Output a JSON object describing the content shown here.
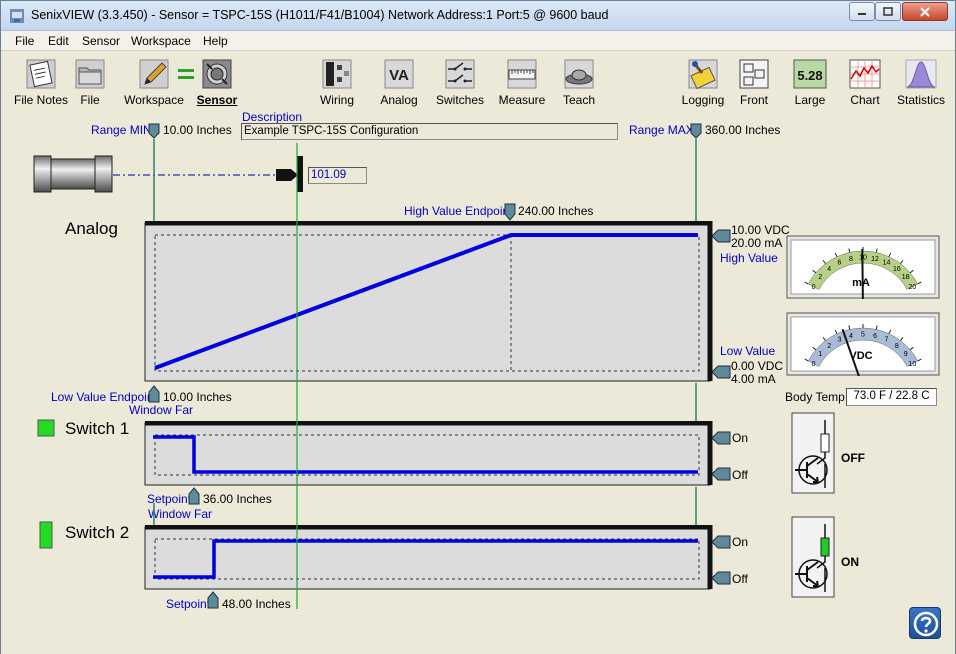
{
  "window": {
    "title": "SenixVIEW (3.3.450) - Sensor = TSPC-15S (H1011/F41/B1004)  Network Address:1  Port:5 @ 9600 baud"
  },
  "menu": [
    "File",
    "Edit",
    "Sensor",
    "Workspace",
    "Help"
  ],
  "toolbar": {
    "file_notes": "File Notes",
    "file": "File",
    "workspace": "Workspace",
    "sensor": "Sensor",
    "wiring": "Wiring",
    "analog": "Analog",
    "switches": "Switches",
    "measure": "Measure",
    "teach": "Teach",
    "logging": "Logging",
    "front": "Front",
    "large": "Large",
    "large_value": "5.28",
    "chart": "Chart",
    "statistics": "Statistics",
    "analog_icon_text": "VA"
  },
  "range": {
    "min_label": "Range MIN",
    "min_value": "10.00 Inches",
    "max_label": "Range MAX",
    "max_value": "360.00 Inches",
    "description_label": "Description",
    "description_value": "Example TSPC-15S Configuration",
    "target_reading": "101.09"
  },
  "analog": {
    "title": "Analog",
    "high_endpoint_label": "High Value Endpoint",
    "high_endpoint_value": "240.00 Inches",
    "low_endpoint_label": "Low Value Endpoint",
    "low_endpoint_value": "10.00 Inches",
    "window_far": "Window Far",
    "high_vdc": "10.00 VDC",
    "high_ma": "20.00 mA",
    "high_value_label": "High Value",
    "low_value_label": "Low Value",
    "low_vdc": "0.00 VDC",
    "low_ma": "4.00 mA"
  },
  "meters": {
    "ma_label": "mA",
    "ma_ticks": [
      "0",
      "2",
      "4",
      "6",
      "8",
      "10",
      "12",
      "14",
      "16",
      "18",
      "20"
    ],
    "ma_reading": 9.9,
    "vdc_label": "VDC",
    "vdc_ticks": [
      "0",
      "1",
      "2",
      "3",
      "4",
      "5",
      "6",
      "7",
      "8",
      "9",
      "10"
    ],
    "vdc_reading": 3.5,
    "body_temp_label": "Body Temp:",
    "body_temp_value": "73.0 F / 22.8 C"
  },
  "switch1": {
    "title": "Switch 1",
    "setpoint_label": "Setpoint",
    "setpoint_value": "36.00 Inches",
    "window_far": "Window Far",
    "on_label": "On",
    "off_label": "Off",
    "state": "OFF",
    "indicator_color": "#22dd22"
  },
  "switch2": {
    "title": "Switch 2",
    "setpoint_label": "Setpoint",
    "setpoint_value": "48.00 Inches",
    "on_label": "On",
    "off_label": "Off",
    "state": "ON",
    "indicator_color": "#22dd22"
  },
  "colors": {
    "signal": "#0000e0",
    "label_blue": "#0000c0",
    "marker_line": "#22aa22"
  }
}
